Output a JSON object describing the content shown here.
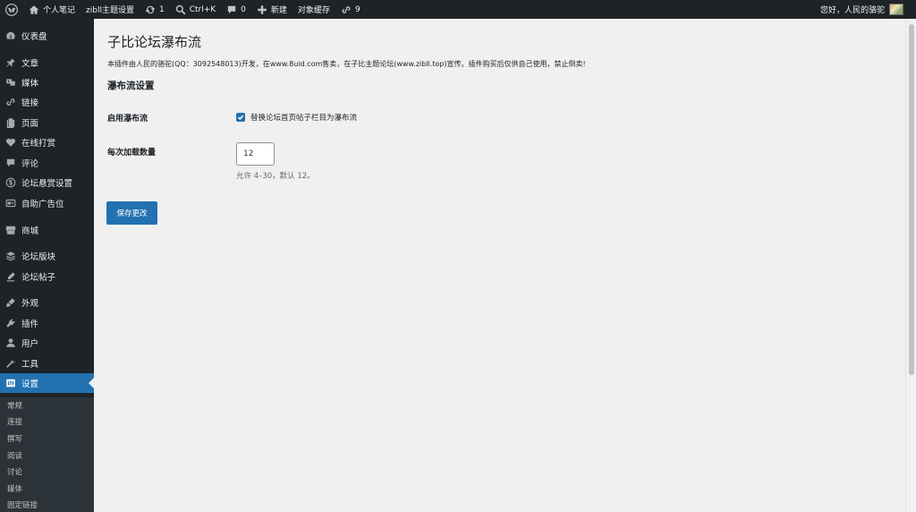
{
  "adminbar": {
    "site_name": "个人笔记",
    "theme_settings": "zibll主题设置",
    "updates_count": "1",
    "search_shortcut": "Ctrl+K",
    "comments_count": "0",
    "new_label": "新建",
    "object_cache": "对象缓存",
    "links_count": "9",
    "greeting": "您好，人民的骆驼"
  },
  "menu": {
    "items": [
      {
        "label": "仪表盘",
        "icon": "dashboard-icon"
      },
      {
        "label": "文章",
        "icon": "pin-icon"
      },
      {
        "label": "媒体",
        "icon": "media-icon"
      },
      {
        "label": "链接",
        "icon": "link-icon"
      },
      {
        "label": "页面",
        "icon": "page-icon"
      },
      {
        "label": "在线打赏",
        "icon": "heart-icon"
      },
      {
        "label": "评论",
        "icon": "comment-icon"
      },
      {
        "label": "论坛悬赏设置",
        "icon": "dollar-icon"
      },
      {
        "label": "自助广告位",
        "icon": "ad-icon"
      },
      {
        "label": "商城",
        "icon": "store-icon"
      },
      {
        "label": "论坛版块",
        "icon": "forum-icon"
      },
      {
        "label": "论坛帖子",
        "icon": "post-icon"
      },
      {
        "label": "外观",
        "icon": "appearance-icon"
      },
      {
        "label": "插件",
        "icon": "plugin-icon"
      },
      {
        "label": "用户",
        "icon": "user-icon"
      },
      {
        "label": "工具",
        "icon": "tool-icon"
      },
      {
        "label": "设置",
        "icon": "settings-icon"
      }
    ],
    "submenu": [
      "常规",
      "连接",
      "撰写",
      "阅读",
      "讨论",
      "媒体",
      "固定链接"
    ]
  },
  "page": {
    "title": "子比论坛瀑布流",
    "intro": "本插件由人民的骆驼(QQ：3092548013)开发，在www.8uid.com售卖，在子比主题论坛(www.zibll.top)宣传。插件购买后仅供自己使用，禁止倒卖!",
    "section_title": "瀑布流设置",
    "enable_label": "启用瀑布流",
    "enable_checkbox_label": "替换论坛首页帖子栏目为瀑布流",
    "enable_checked": true,
    "count_label": "每次加载数量",
    "count_value": "12",
    "count_hint": "允许 4–30，默认 12。",
    "save_label": "保存更改"
  }
}
